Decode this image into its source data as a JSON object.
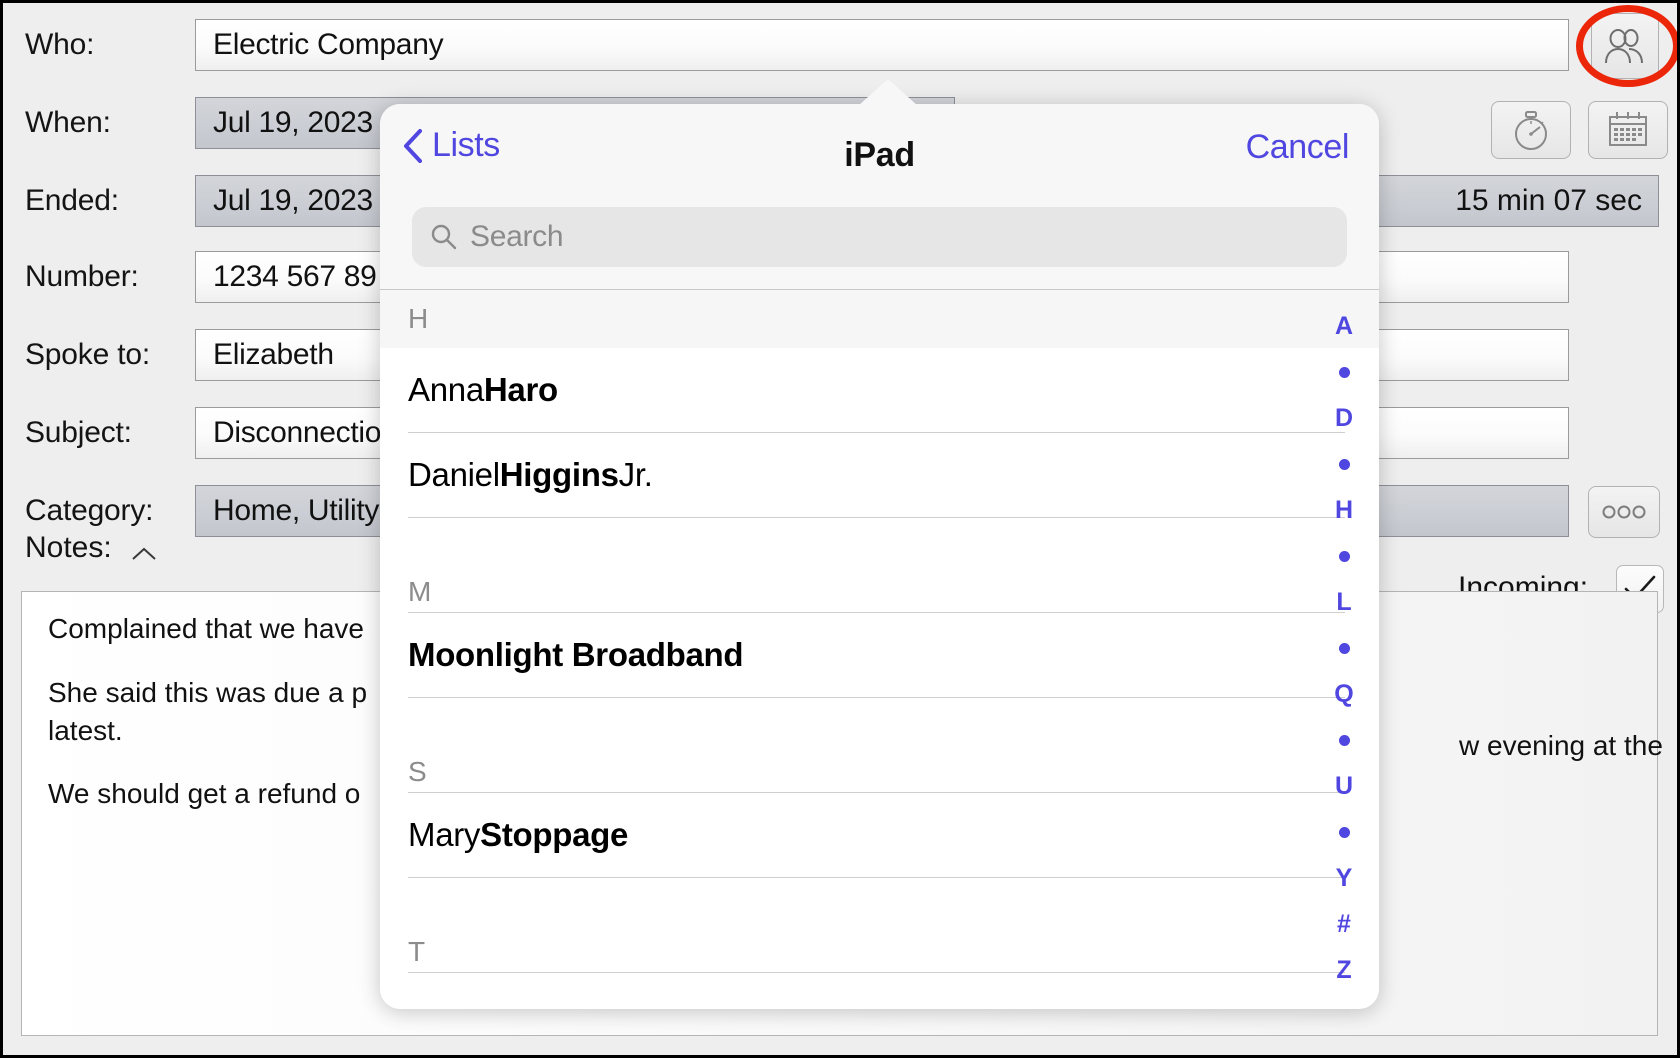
{
  "form": {
    "fields": [
      {
        "label": "Who:",
        "value": "Electric Company",
        "style": "white"
      },
      {
        "label": "When:",
        "value": "Jul 19, 2023",
        "style": "gray"
      },
      {
        "label": "Ended:",
        "value": "Jul 19, 2023",
        "style": "gray"
      },
      {
        "label": "Number:",
        "value": "1234 567 89",
        "style": "white"
      },
      {
        "label": "Spoke to:",
        "value": "Elizabeth",
        "style": "white"
      },
      {
        "label": "Subject:",
        "value": "Disconnection",
        "style": "white"
      },
      {
        "label": "Category:",
        "value": "Home, Utility",
        "style": "gray"
      }
    ],
    "notes_label": "Notes:",
    "notes_text": [
      "Complained that we have",
      "She said this was due a p",
      "latest.",
      "We should get a refund o"
    ],
    "notes_right_fragment": "w evening at the",
    "duration": "15 min 07 sec",
    "incoming_label": "Incoming:",
    "incoming_checked": true,
    "buttons": {
      "contacts": "contacts-icon",
      "stopwatch": "stopwatch-icon",
      "calendar": "calendar-icon",
      "more": "more-options-icon"
    }
  },
  "popover": {
    "back_label": "Lists",
    "title": "iPad",
    "cancel_label": "Cancel",
    "search": {
      "placeholder": "Search",
      "value": ""
    },
    "sections": [
      {
        "letter": "H",
        "style": "shaded",
        "contacts": [
          {
            "first": "Anna ",
            "last": "Haro",
            "suffix": ""
          },
          {
            "first": "Daniel ",
            "last": "Higgins",
            "suffix": " Jr."
          }
        ]
      },
      {
        "letter": "M",
        "style": "plain",
        "contacts": [
          {
            "first": "",
            "last": "Moonlight Broadband",
            "suffix": ""
          }
        ]
      },
      {
        "letter": "S",
        "style": "plain",
        "contacts": [
          {
            "first": "Mary ",
            "last": "Stoppage",
            "suffix": ""
          }
        ]
      },
      {
        "letter": "T",
        "style": "plain",
        "contacts": []
      }
    ],
    "index_bar": [
      "A",
      "•",
      "D",
      "•",
      "H",
      "•",
      "L",
      "•",
      "Q",
      "•",
      "U",
      "•",
      "Y",
      "#",
      "Z"
    ]
  },
  "colors": {
    "accent": "#5046e0",
    "annotation": "#ec2609",
    "section_header_text": "#8c8c8c"
  },
  "annotation": {
    "shape": "red-ellipse-highlight",
    "target": "contacts-icon"
  }
}
